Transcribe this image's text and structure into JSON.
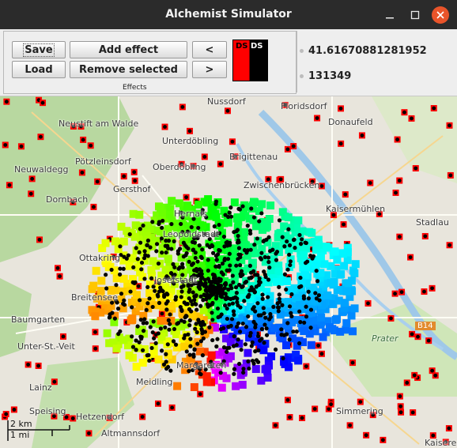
{
  "window": {
    "title": "Alchemist Simulator"
  },
  "toolbar": {
    "save_label": "Save",
    "load_label": "Load",
    "add_effect_label": "Add effect",
    "remove_selected_label": "Remove selected",
    "prev_label": "<",
    "next_label": ">",
    "effects_label": "Effects",
    "ds_left": "DS",
    "ds_right": "DS"
  },
  "status": {
    "time": "41.61670881281952",
    "step": "131349"
  },
  "map": {
    "places": [
      "Nussdorf",
      "Floridsdorf",
      "Donaufeld",
      "Neustift am Walde",
      "Unterdöbling",
      "Pötzleinsdorf",
      "Neuwaldegg",
      "Oberdöbling",
      "Brigittenau",
      "Gersthof",
      "Dornbach",
      "Zwischenbrücken",
      "Hernals",
      "Leopoldstadt",
      "Kaisermühlen",
      "Stadlau",
      "Ottakring",
      "Josefstadt",
      "Breitensee",
      "Baumgarten",
      "Unter-St.-Veit",
      "Margareten",
      "Meidling",
      "Lainz",
      "Speising",
      "Hetzendorf",
      "Altmannsdorf",
      "Simmering",
      "Kaisere",
      "Prater",
      "B14"
    ],
    "scale_km": "2 km",
    "scale_mi": "1 mi"
  },
  "colors": {
    "accent_close": "#e9542a",
    "node_red": "#ff0000",
    "node_black": "#000000"
  }
}
